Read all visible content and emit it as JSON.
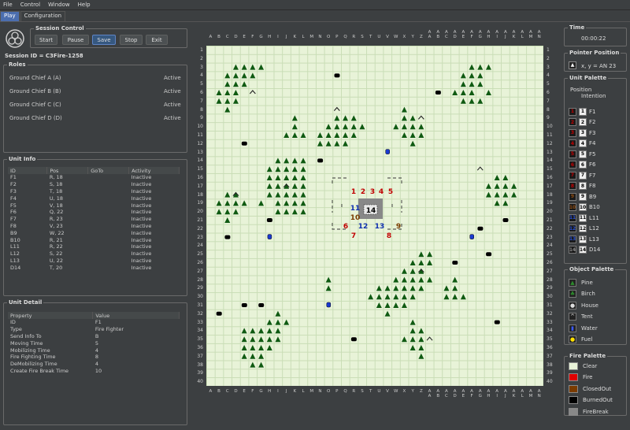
{
  "menu": [
    "File",
    "Control",
    "Window",
    "Help"
  ],
  "tabs": [
    {
      "label": "Play",
      "active": true
    },
    {
      "label": "Configuration",
      "active": false
    }
  ],
  "session": {
    "legend": "Session Control",
    "buttons": [
      "Start",
      "Pause",
      "Save",
      "Stop",
      "Exit"
    ],
    "id_text": "Session ID = C3Fire-1258"
  },
  "roles": {
    "legend": "Roles",
    "items": [
      {
        "name": "Ground Chief A",
        "code": "(A)",
        "status": "Active"
      },
      {
        "name": "Ground Chief B",
        "code": "(B)",
        "status": "Active"
      },
      {
        "name": "Ground Chief C",
        "code": "(C)",
        "status": "Active"
      },
      {
        "name": "Ground Chief D",
        "code": "(D)",
        "status": "Active"
      }
    ]
  },
  "unit_info": {
    "legend": "Unit Info",
    "columns": [
      "ID",
      "Pos",
      "GoTo",
      "Activity"
    ],
    "rows": [
      [
        "F1",
        "R, 18",
        "",
        "Inactive"
      ],
      [
        "F2",
        "S, 18",
        "",
        "Inactive"
      ],
      [
        "F3",
        "T, 18",
        "",
        "Inactive"
      ],
      [
        "F4",
        "U, 18",
        "",
        "Inactive"
      ],
      [
        "F5",
        "V, 18",
        "",
        "Inactive"
      ],
      [
        "F6",
        "Q, 22",
        "",
        "Inactive"
      ],
      [
        "F7",
        "R, 23",
        "",
        "Inactive"
      ],
      [
        "F8",
        "V, 23",
        "",
        "Inactive"
      ],
      [
        "B9",
        "W, 22",
        "",
        "Inactive"
      ],
      [
        "B10",
        "R, 21",
        "",
        "Inactive"
      ],
      [
        "L11",
        "R, 22",
        "",
        "Inactive"
      ],
      [
        "L12",
        "S, 22",
        "",
        "Inactive"
      ],
      [
        "L13",
        "U, 22",
        "",
        "Inactive"
      ],
      [
        "D14",
        "T, 20",
        "",
        "Inactive"
      ]
    ]
  },
  "unit_detail": {
    "legend": "Unit Detail",
    "columns": [
      "Property",
      "Value"
    ],
    "rows": [
      [
        "ID",
        "F1"
      ],
      [
        "Type",
        "Fire Fighter"
      ],
      [
        "Send Info To",
        "B"
      ],
      [
        "Moving Time",
        "5"
      ],
      [
        "Mobilizing Time",
        "4"
      ],
      [
        "Fire Fighting Time",
        "8"
      ],
      [
        "DeMobilizing Time",
        "4"
      ],
      [
        "Create Fire Break Time",
        "10"
      ]
    ]
  },
  "map": {
    "col_top": [
      "",
      "",
      "",
      "",
      "",
      "",
      "",
      "",
      "",
      "",
      "",
      "",
      "",
      "",
      "",
      "",
      "",
      "",
      "",
      "",
      "",
      "",
      "",
      "",
      "",
      "",
      "A",
      "A",
      "A",
      "A",
      "A",
      "A",
      "A",
      "A",
      "A",
      "A",
      "A",
      "A",
      "A",
      "A"
    ],
    "col_bottom": [
      "A",
      "B",
      "C",
      "D",
      "E",
      "F",
      "G",
      "H",
      "I",
      "J",
      "K",
      "L",
      "M",
      "N",
      "O",
      "P",
      "Q",
      "R",
      "S",
      "T",
      "U",
      "V",
      "W",
      "X",
      "Y",
      "Z",
      "A",
      "B",
      "C",
      "D",
      "E",
      "F",
      "G",
      "H",
      "I",
      "J",
      "K",
      "L",
      "M",
      "N"
    ],
    "rows": [
      "1",
      "2",
      "3",
      "4",
      "5",
      "6",
      "7",
      "8",
      "9",
      "10",
      "11",
      "12",
      "13",
      "14",
      "15",
      "16",
      "17",
      "18",
      "19",
      "20",
      "21",
      "22",
      "23",
      "24",
      "25",
      "26",
      "27",
      "28",
      "29",
      "30",
      "31",
      "32",
      "33",
      "34",
      "35",
      "36",
      "37",
      "38",
      "39",
      "40"
    ],
    "units": [
      {
        "label": "1",
        "color": "#c00000"
      },
      {
        "label": "2",
        "color": "#c00000"
      },
      {
        "label": "3",
        "color": "#c00000"
      },
      {
        "label": "4",
        "color": "#c00000"
      },
      {
        "label": "5",
        "color": "#c00000"
      },
      {
        "label": "6",
        "color": "#c00000"
      },
      {
        "label": "7",
        "color": "#c00000"
      },
      {
        "label": "8",
        "color": "#c00000"
      },
      {
        "label": "9",
        "color": "#7a3b00"
      },
      {
        "label": "10",
        "color": "#7a3b00"
      },
      {
        "label": "11",
        "color": "#1030b0"
      },
      {
        "label": "12",
        "color": "#1030b0"
      },
      {
        "label": "13",
        "color": "#1030b0"
      },
      {
        "label": "14",
        "color": "#000000"
      }
    ]
  },
  "time": {
    "legend": "Time",
    "value": "00:00:22"
  },
  "pointer": {
    "legend": "Pointer Position",
    "text": "x, y = AN 23"
  },
  "unit_palette": {
    "legend": "Unit Palette",
    "header_pos": "Position",
    "header_int": "Intention",
    "items": [
      {
        "num": "1",
        "label": "F1",
        "color": "#c00000"
      },
      {
        "num": "2",
        "label": "F2",
        "color": "#c00000"
      },
      {
        "num": "3",
        "label": "F3",
        "color": "#c00000"
      },
      {
        "num": "4",
        "label": "F4",
        "color": "#c00000"
      },
      {
        "num": "5",
        "label": "F5",
        "color": "#c00000"
      },
      {
        "num": "6",
        "label": "F6",
        "color": "#c00000"
      },
      {
        "num": "7",
        "label": "F7",
        "color": "#c00000"
      },
      {
        "num": "8",
        "label": "F8",
        "color": "#c00000"
      },
      {
        "num": "9",
        "label": "B9",
        "color": "#8a4a10"
      },
      {
        "num": "10",
        "label": "B10",
        "color": "#8a4a10"
      },
      {
        "num": "11",
        "label": "L11",
        "color": "#2a50d0"
      },
      {
        "num": "12",
        "label": "L12",
        "color": "#2a50d0"
      },
      {
        "num": "13",
        "label": "L13",
        "color": "#2a50d0"
      },
      {
        "num": "14",
        "label": "D14",
        "color": "#888888"
      }
    ]
  },
  "object_palette": {
    "legend": "Object Palette",
    "items": [
      {
        "label": "Pine",
        "icon": "pine-icon"
      },
      {
        "label": "Birch",
        "icon": "birch-icon"
      },
      {
        "label": "House",
        "icon": "house-icon"
      },
      {
        "label": "Tent",
        "icon": "tent-icon"
      },
      {
        "label": "Water",
        "icon": "water-icon"
      },
      {
        "label": "Fuel",
        "icon": "fuel-icon"
      }
    ]
  },
  "fire_palette": {
    "legend": "Fire Palette",
    "items": [
      {
        "label": "Clear",
        "color": "#e8f3d8"
      },
      {
        "label": "Fire",
        "color": "#e00000"
      },
      {
        "label": "ClosedOut",
        "color": "#7a3b00"
      },
      {
        "label": "BurnedOut",
        "color": "#000000"
      },
      {
        "label": "FireBreak",
        "color": "#888888"
      }
    ]
  }
}
